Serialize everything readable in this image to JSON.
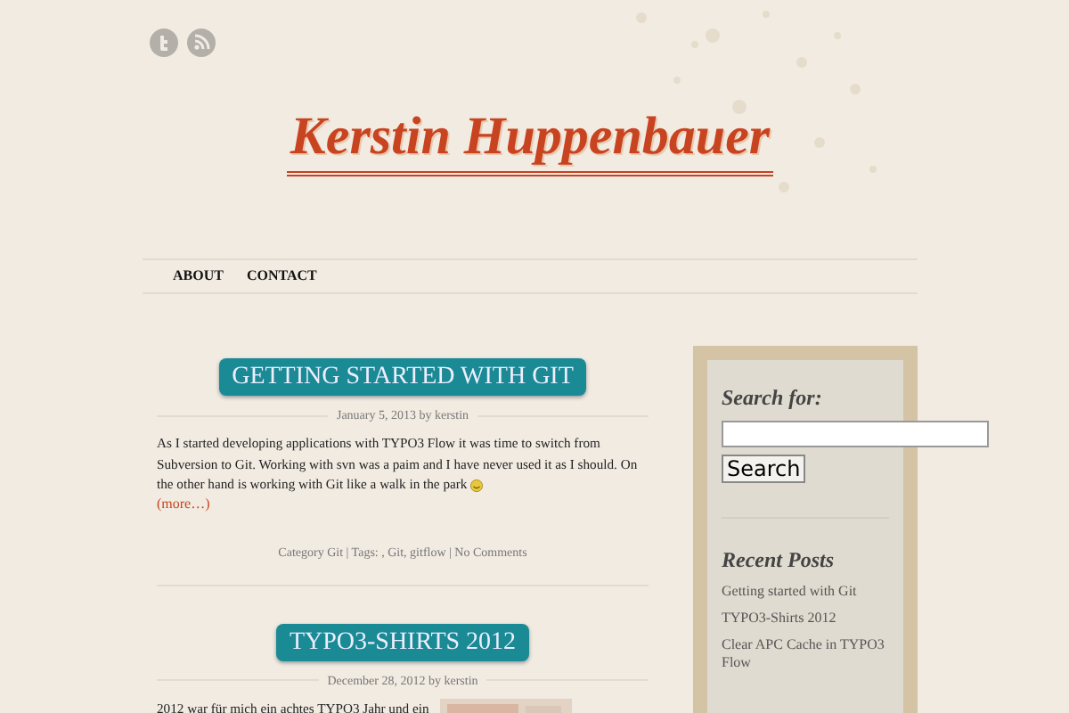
{
  "social": [
    {
      "kind": "twitter"
    },
    {
      "kind": "rss"
    }
  ],
  "site_title": "Kerstin Huppenbauer",
  "nav": [
    {
      "label": "ABOUT"
    },
    {
      "label": "CONTACT"
    }
  ],
  "posts": [
    {
      "title": "GETTING STARTED WITH GIT",
      "meta": "January 5, 2013 by kerstin",
      "excerpt": "As I started developing applications with TYPO3 Flow it was time to switch from Subversion to Git. Working with svn was a paim and I have never used it as I should. On the other hand is working with Git like a walk in the park",
      "kind": "smiley",
      "more": "(more…)",
      "footer": "Category Git | Tags: , Git, gitflow | No Comments"
    },
    {
      "title": "TYPO3-SHIRTS 2012",
      "meta": "December 28, 2012 by kerstin",
      "excerpt": "2012 war für mich ein achtes TYPO3 Jahr und ein",
      "kind": "plain"
    }
  ],
  "sidebar": {
    "search_heading": "Search for:",
    "search_button": "Search",
    "recent_heading": "Recent Posts",
    "recent_posts": [
      "Getting started with Git",
      "TYPO3-Shirts 2012",
      "Clear APC Cache in TYPO3 Flow"
    ]
  }
}
